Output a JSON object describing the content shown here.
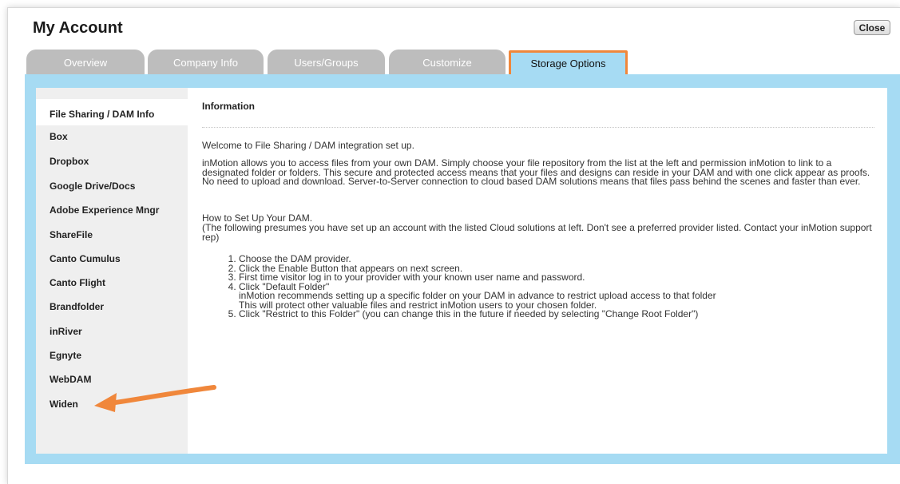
{
  "window": {
    "title": "My Account",
    "close_label": "Close"
  },
  "tabs": [
    {
      "label": "Overview",
      "active": false
    },
    {
      "label": "Company Info",
      "active": false
    },
    {
      "label": "Users/Groups",
      "active": false
    },
    {
      "label": "Customize",
      "active": false
    },
    {
      "label": "Storage Options",
      "active": true
    }
  ],
  "sidebar": {
    "items": [
      {
        "label": "File Sharing / DAM Info",
        "active": true
      },
      {
        "label": "Box"
      },
      {
        "label": "Dropbox"
      },
      {
        "label": "Google Drive/Docs"
      },
      {
        "label": "Adobe Experience Mngr"
      },
      {
        "label": "ShareFile"
      },
      {
        "label": "Canto Cumulus"
      },
      {
        "label": "Canto Flight"
      },
      {
        "label": "Brandfolder"
      },
      {
        "label": "inRiver"
      },
      {
        "label": "Egnyte"
      },
      {
        "label": "WebDAM"
      },
      {
        "label": "Widen"
      }
    ]
  },
  "content": {
    "heading": "Information",
    "welcome": "Welcome to File Sharing / DAM integration set up.",
    "intro": "inMotion allows you to access files from your own DAM. Simply choose your file repository from the list at the left and permission inMotion to link to a designated folder or folders. This secure and protected access means that your files and designs can reside in your DAM and with one click appear as proofs. No need to upload and download. Server-to-Server connection to cloud based DAM solutions means that files pass behind the scenes and faster than ever.",
    "setup_title": "How to Set Up Your DAM.",
    "setup_note": "(The following presumes you have set up an account with the listed Cloud solutions at left. Don't see a preferred provider listed. Contact your inMotion support rep)",
    "steps": [
      "Choose the DAM provider.",
      "Click the Enable Button that appears on next screen.",
      "First time visitor log in to your provider with your known user name and password.",
      "Click \"Default Folder\"",
      "Click \"Restrict to this Folder\" (you can change this in the future if needed by selecting \"Change Root Folder\")"
    ],
    "step4_sub1": "inMotion recommends setting up a specific folder on your DAM in advance to restrict upload access to that folder",
    "step4_sub2": "This will protect other valuable files and restrict inMotion users to your chosen folder."
  },
  "colors": {
    "panel_bg": "#a6dbf3",
    "tab_inactive": "#bdbdbd",
    "highlight": "#f0873b",
    "sidebar_bg": "#efefef"
  }
}
